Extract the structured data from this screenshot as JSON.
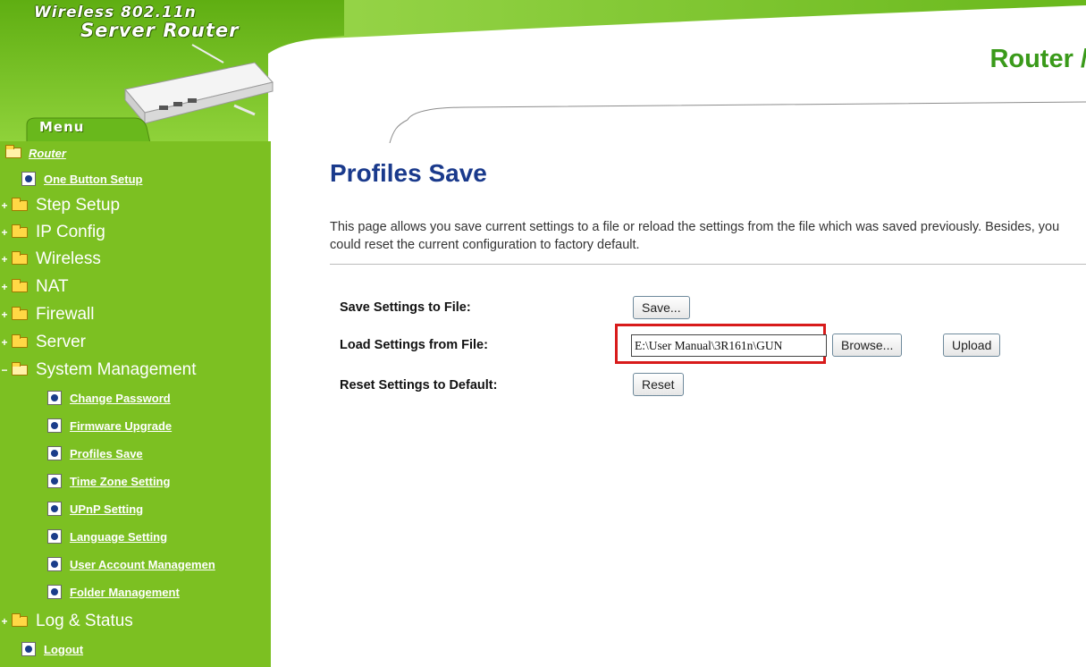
{
  "header": {
    "brand_line1": "Wireless 802.11n",
    "brand_line2": "Server Router",
    "title": "Router /",
    "menu_tab": "Menu"
  },
  "sidebar": {
    "root": "Router",
    "items": [
      {
        "type": "leaf",
        "label": "One Button Setup"
      },
      {
        "type": "folder",
        "label": "Step Setup",
        "expander": "+"
      },
      {
        "type": "folder",
        "label": "IP Config",
        "expander": "+"
      },
      {
        "type": "folder",
        "label": "Wireless",
        "expander": "+"
      },
      {
        "type": "folder",
        "label": "NAT",
        "expander": "+"
      },
      {
        "type": "folder",
        "label": "Firewall",
        "expander": "+"
      },
      {
        "type": "folder",
        "label": "Server",
        "expander": "+"
      },
      {
        "type": "folder",
        "label": "System Management",
        "expander": "−",
        "open": true
      },
      {
        "type": "sub",
        "label": "Change Password"
      },
      {
        "type": "sub",
        "label": "Firmware Upgrade"
      },
      {
        "type": "sub",
        "label": "Profiles Save"
      },
      {
        "type": "sub",
        "label": "Time Zone Setting"
      },
      {
        "type": "sub",
        "label": "UPnP Setting"
      },
      {
        "type": "sub",
        "label": "Language Setting"
      },
      {
        "type": "sub",
        "label": "User Account Managemen"
      },
      {
        "type": "sub",
        "label": "Folder Management"
      },
      {
        "type": "folder",
        "label": "Log & Status",
        "expander": "+"
      },
      {
        "type": "leaf",
        "label": "Logout"
      }
    ]
  },
  "main": {
    "title": "Profiles Save",
    "description": "This page allows you save current settings to a file or reload the settings from the file which was saved previously. Besides, you could reset the current configuration to factory default.",
    "save_label": "Save Settings to File:",
    "load_label": "Load Settings from File:",
    "reset_label": "Reset Settings to Default:",
    "save_button": "Save...",
    "file_value": "E:\\User Manual\\3R161n\\GUN",
    "browse_button": "Browse...",
    "upload_button": "Upload",
    "reset_button": "Reset"
  },
  "colors": {
    "sidebar_green": "#7cc022",
    "title_blue": "#1a3a8c",
    "highlight_red": "#d81b1b"
  }
}
